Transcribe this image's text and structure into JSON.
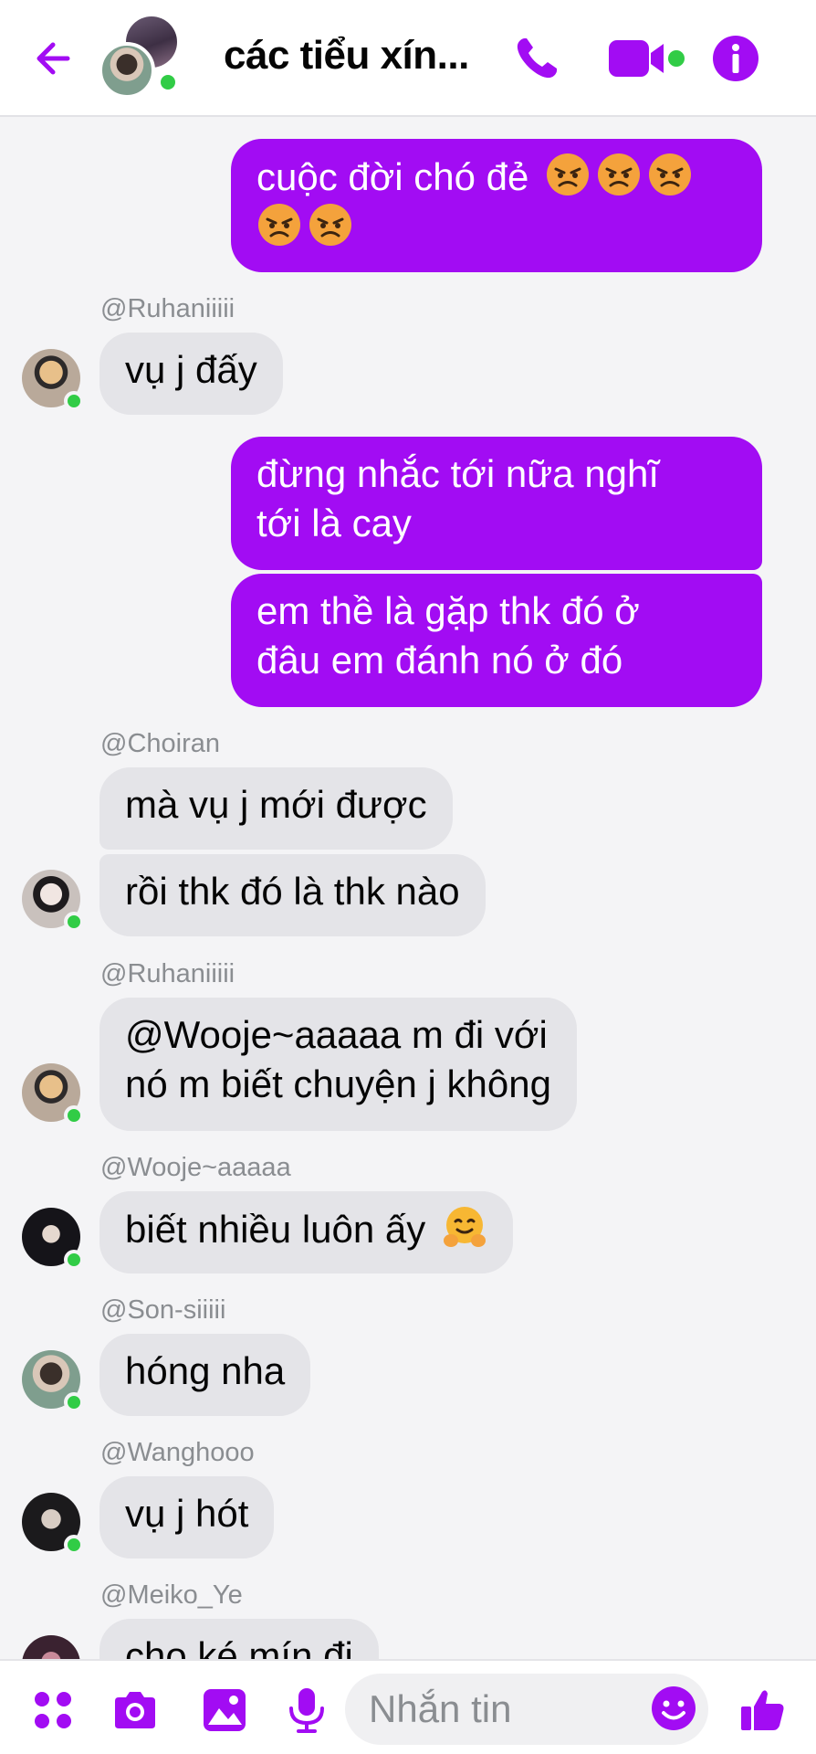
{
  "header": {
    "title": "các tiểu xín...",
    "accent_color": "#a20cf3",
    "online_color": "#31cc46"
  },
  "messages": {
    "out1": "cuộc đời chó đẻ",
    "ruhan1_sender": "@Ruhaniiiii",
    "ruhan1": "vụ j đấy",
    "out2_line1": "đừng nhắc tới nữa nghĩ",
    "out2_line2": "tới là cay",
    "out3_line1": "em thề là gặp thk đó ở",
    "out3_line2": "đâu em đánh nó ở đó",
    "choiran_sender": "@Choiran",
    "choiran1": "mà vụ j mới được",
    "choiran2": "rồi thk đó là thk nào",
    "ruhan2_sender": "@Ruhaniiiii",
    "ruhan2_line1": "@Wooje~aaaaa m đi với",
    "ruhan2_line2": "nó m biết chuyện j không",
    "wooje_sender": "@Wooje~aaaaa",
    "wooje1": "biết nhiều luôn ấy",
    "son_sender": "@Son-siiiii",
    "son1": "hóng nha",
    "wang_sender": "@Wanghooo",
    "wang1": "vụ j hót",
    "meiko_sender": "@Meiko_Ye",
    "meiko1": "cho ké mín đi"
  },
  "composer": {
    "placeholder": "Nhắn tin"
  },
  "icons": {
    "back": "back-arrow-icon",
    "call": "phone-icon",
    "video": "video-camera-icon",
    "info": "info-icon",
    "menu": "four-dots-menu-icon",
    "camera": "camera-icon",
    "gallery": "image-icon",
    "mic": "microphone-icon",
    "emoji": "smiley-icon",
    "like": "thumbs-up-icon"
  }
}
